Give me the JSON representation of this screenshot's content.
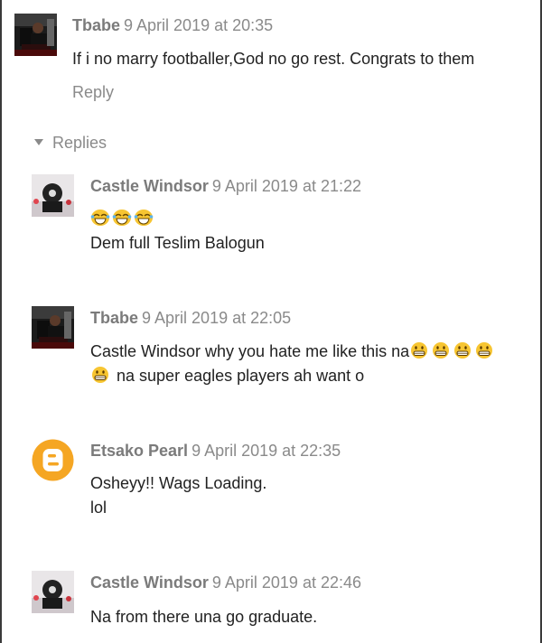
{
  "thread": {
    "top": {
      "author": "Tbabe",
      "timestamp": "9 April 2019 at 20:35",
      "text": "If i no marry footballer,God no go rest. Congrats to them",
      "reply_label": "Reply"
    },
    "replies_label": "Replies",
    "replies": [
      {
        "author": "Castle Windsor",
        "timestamp": "9 April 2019 at 21:22",
        "emoji": "laughing-tears-icon ×3",
        "line2": "Dem full Teslim Balogun"
      },
      {
        "author": "Tbabe",
        "timestamp": "9 April 2019 at 22:05",
        "line1": "Castle Windsor why you hate me like this na",
        "line2": "na super eagles players ah want o",
        "emoji": "grinning-face-icon ×5"
      },
      {
        "author": "Etsako Pearl",
        "timestamp": "9 April 2019 at 22:35",
        "line1": "Osheyy!! Wags Loading.",
        "line2": "lol"
      },
      {
        "author": "Castle Windsor",
        "timestamp": "9 April 2019 at 22:46",
        "line1": "Na from there una go graduate."
      }
    ]
  },
  "colors": {
    "meta_gray": "#8a8a8a",
    "author_gray": "#7b7b7b",
    "blogger_orange": "#f5a623",
    "emoji_yellow": "#f7c531"
  }
}
